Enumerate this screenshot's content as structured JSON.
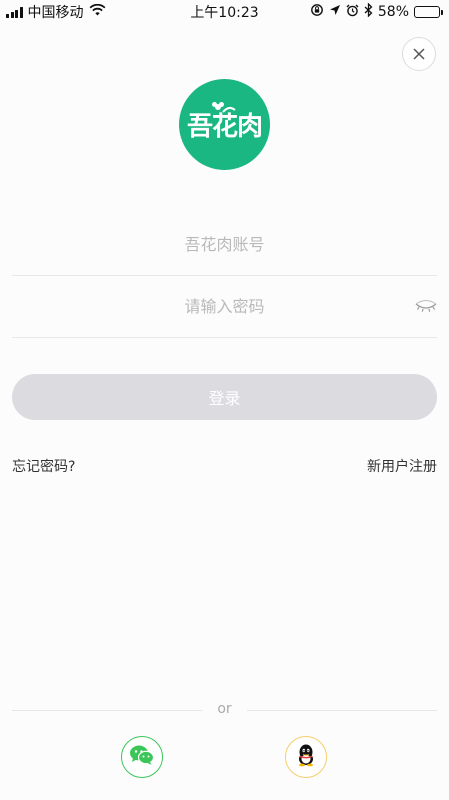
{
  "status_bar": {
    "carrier": "中国移动",
    "time": "上午10:23",
    "battery": "58%",
    "battery_level": 0.58,
    "icons": [
      "signal-icon",
      "wifi-icon",
      "orientation-lock-icon",
      "location-icon",
      "alarm-icon",
      "bluetooth-icon",
      "battery-icon"
    ]
  },
  "close_icon": "close-icon",
  "logo": {
    "text": "吾花肉",
    "color": "#1bb783"
  },
  "form": {
    "account_placeholder": "吾花肉账号",
    "password_placeholder": "请输入密码",
    "eye_icon": "eye-closed-icon",
    "login_label": "登录",
    "login_color": "#dcdbdf"
  },
  "links": {
    "forgot_password": "忘记密码?",
    "register": "新用户注册"
  },
  "social": {
    "divider_text": "or",
    "wechat_icon": "wechat-icon",
    "wechat_color": "#3cc65a",
    "qq_icon": "qq-icon",
    "qq_color": "#f3cf6a"
  }
}
